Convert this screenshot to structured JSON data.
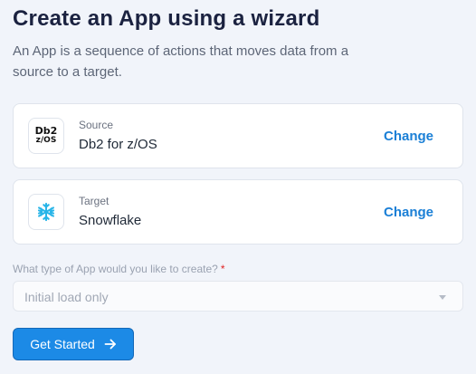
{
  "header": {
    "title": "Create an App using a wizard",
    "subtitle": "An App is a sequence of actions that moves data from a source to a target."
  },
  "source": {
    "label": "Source",
    "value": "Db2 for z/OS",
    "icon": "db2-logo-icon",
    "icon_text_line1": "Db2",
    "icon_text_line2": "z/OS",
    "change_label": "Change"
  },
  "target": {
    "label": "Target",
    "value": "Snowflake",
    "icon": "snowflake-icon",
    "change_label": "Change"
  },
  "app_type": {
    "question": "What type of App would you like to create?",
    "required_marker": "*",
    "selected": "Initial load only"
  },
  "actions": {
    "primary_label": "Get Started",
    "primary_icon": "arrow-right-icon"
  },
  "colors": {
    "accent": "#1c8ae6",
    "link": "#1a7fd6",
    "required": "#e02424",
    "snowflake": "#29b5e8"
  }
}
